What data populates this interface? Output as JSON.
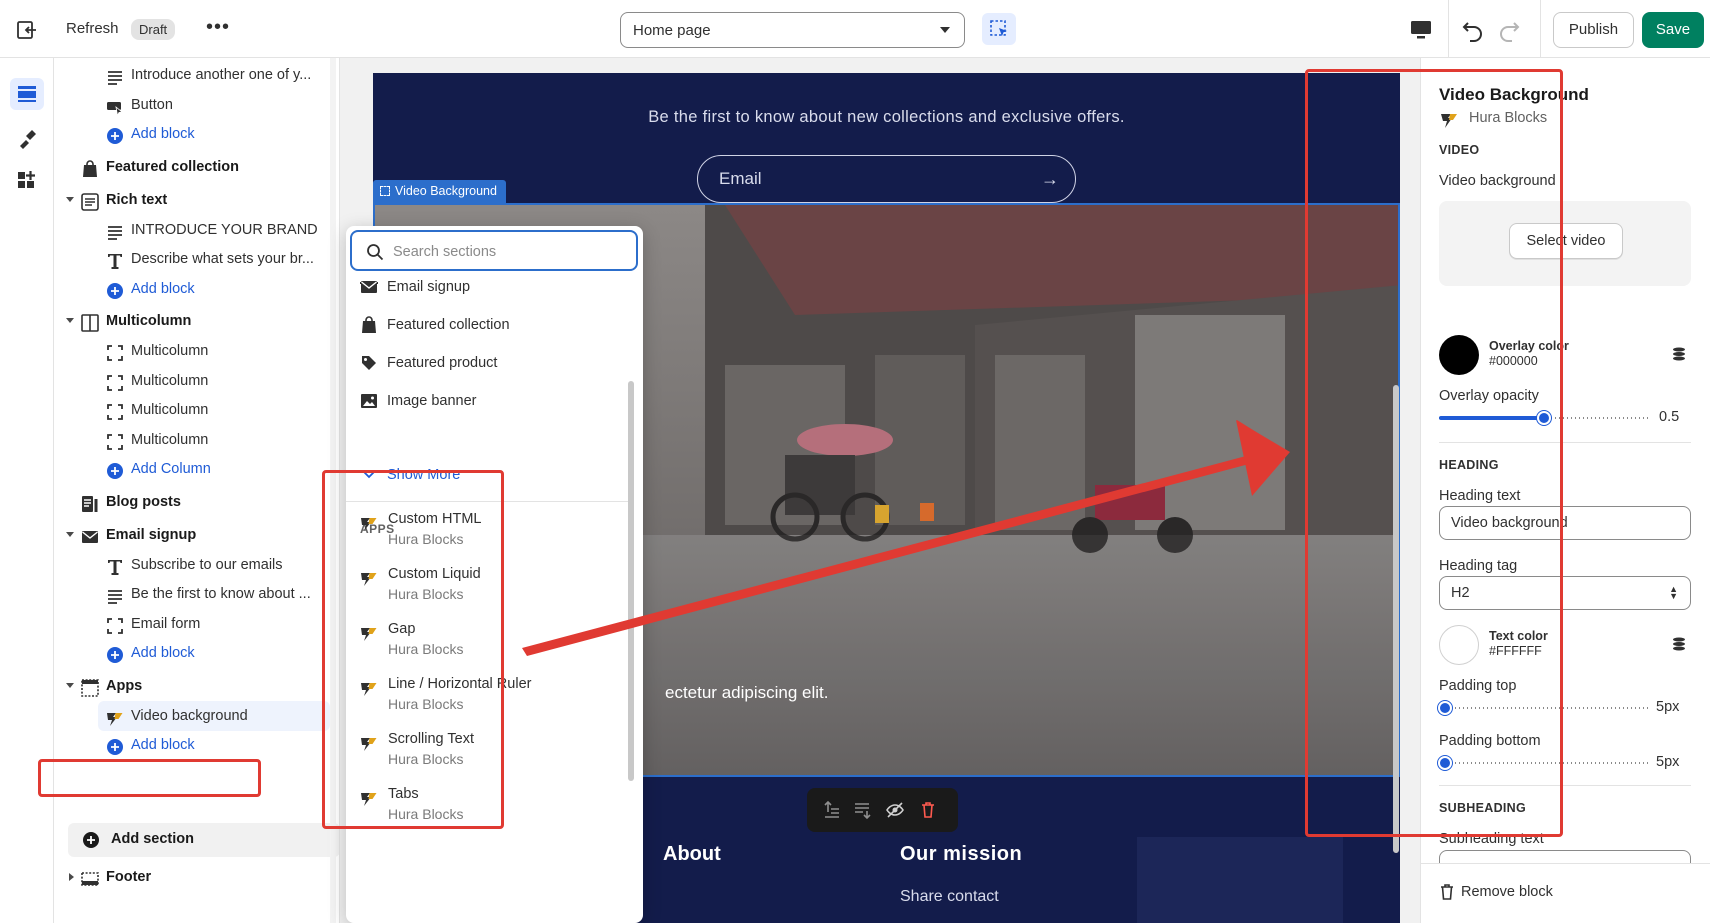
{
  "topbar": {
    "refresh_label": "Refresh",
    "status_badge": "Draft",
    "more_label": "•••",
    "page_select_value": "Home page",
    "publish_label": "Publish",
    "save_label": "Save"
  },
  "sidebar": {
    "rows": [
      {
        "type": "block",
        "icon": "text-icon",
        "label": "Introduce another one of y..."
      },
      {
        "type": "block",
        "icon": "button-icon",
        "label": "Button"
      },
      {
        "type": "add",
        "icon": "plus-circle-icon",
        "label": "Add block"
      },
      {
        "type": "section",
        "icon": "featured-collection-icon",
        "label": "Featured collection"
      },
      {
        "type": "section",
        "icon": "rich-text-icon",
        "label": "Rich text",
        "expanded": true
      },
      {
        "type": "block",
        "icon": "text-icon",
        "label": "INTRODUCE YOUR BRAND"
      },
      {
        "type": "block",
        "icon": "type-t-icon",
        "label": "Describe what sets your br..."
      },
      {
        "type": "add",
        "icon": "plus-circle-icon",
        "label": "Add block"
      },
      {
        "type": "section",
        "icon": "multicolumn-icon",
        "label": "Multicolumn",
        "expanded": true
      },
      {
        "type": "block",
        "icon": "column-frame-icon",
        "label": "Multicolumn"
      },
      {
        "type": "block",
        "icon": "column-frame-icon",
        "label": "Multicolumn"
      },
      {
        "type": "block",
        "icon": "column-frame-icon",
        "label": "Multicolumn"
      },
      {
        "type": "block",
        "icon": "column-frame-icon",
        "label": "Multicolumn"
      },
      {
        "type": "add",
        "icon": "plus-circle-icon",
        "label": "Add Column"
      },
      {
        "type": "section",
        "icon": "blog-posts-icon",
        "label": "Blog posts"
      },
      {
        "type": "section",
        "icon": "email-icon",
        "label": "Email signup",
        "expanded": true
      },
      {
        "type": "block",
        "icon": "type-t-icon",
        "label": "Subscribe to our emails"
      },
      {
        "type": "block",
        "icon": "text-icon",
        "label": "Be the first to know about ..."
      },
      {
        "type": "block",
        "icon": "column-frame-icon",
        "label": "Email form"
      },
      {
        "type": "add",
        "icon": "plus-circle-icon",
        "label": "Add block"
      },
      {
        "type": "section",
        "icon": "apps-icon",
        "label": "Apps",
        "expanded": true
      },
      {
        "type": "block",
        "icon": "hura-blocks-icon",
        "label": "Video background",
        "selected": true
      },
      {
        "type": "add",
        "icon": "plus-circle-icon",
        "label": "Add block"
      }
    ],
    "add_section_label": "Add section",
    "footer_label": "Footer"
  },
  "preview": {
    "tagline": "Be the first to know about new collections and exclusive offers.",
    "email_placeholder": "Email",
    "email_arrow": "→",
    "video_tag_label": "Video Background",
    "video_text": "ectetur adipiscing elit.",
    "about_heading": "About",
    "mission_heading": "Our mission",
    "mission_text": "Share contact"
  },
  "picker": {
    "search_placeholder": "Search sections",
    "items": [
      {
        "icon": "email-icon",
        "label": "Email signup"
      },
      {
        "icon": "featured-collection-icon",
        "label": "Featured collection"
      },
      {
        "icon": "tag-icon",
        "label": "Featured product"
      },
      {
        "icon": "image-icon",
        "label": "Image banner"
      }
    ],
    "show_more_label": "Show More",
    "apps_title": "APPS",
    "apps": [
      {
        "title": "Custom HTML",
        "vendor": "Hura Blocks"
      },
      {
        "title": "Custom Liquid",
        "vendor": "Hura Blocks"
      },
      {
        "title": "Gap",
        "vendor": "Hura Blocks"
      },
      {
        "title": "Line / Horizontal Ruler",
        "vendor": "Hura Blocks"
      },
      {
        "title": "Scrolling Text",
        "vendor": "Hura Blocks"
      },
      {
        "title": "Tabs",
        "vendor": "Hura Blocks"
      }
    ]
  },
  "settings": {
    "title": "Video Background",
    "app_name": "Hura Blocks",
    "video_heading": "VIDEO",
    "video_bg_label": "Video background",
    "select_video_label": "Select video",
    "overlay_color_label": "Overlay color",
    "overlay_color_value": "#000000",
    "overlay_opacity_label": "Overlay opacity",
    "overlay_opacity_value": "0.5",
    "overlay_opacity_fraction": 0.5,
    "heading_section": "HEADING",
    "heading_text_label": "Heading text",
    "heading_text_value": "Video background",
    "heading_tag_label": "Heading tag",
    "heading_tag_value": "H2",
    "text_color_label": "Text color",
    "text_color_value": "#FFFFFF",
    "padding_top_label": "Padding top",
    "padding_top_value": "5px",
    "padding_top_fraction": 0.03,
    "padding_bottom_label": "Padding bottom",
    "padding_bottom_value": "5px",
    "padding_bottom_fraction": 0.03,
    "subheading_section": "SUBHEADING",
    "subheading_text_label": "Subheading text",
    "remove_block_label": "Remove block"
  },
  "colors": {
    "accent": "#1f5bd6",
    "save_green": "#008060",
    "site_navy": "#131c4b",
    "highlight_red": "#e03a32",
    "selection_blue": "#2c6ecb"
  }
}
